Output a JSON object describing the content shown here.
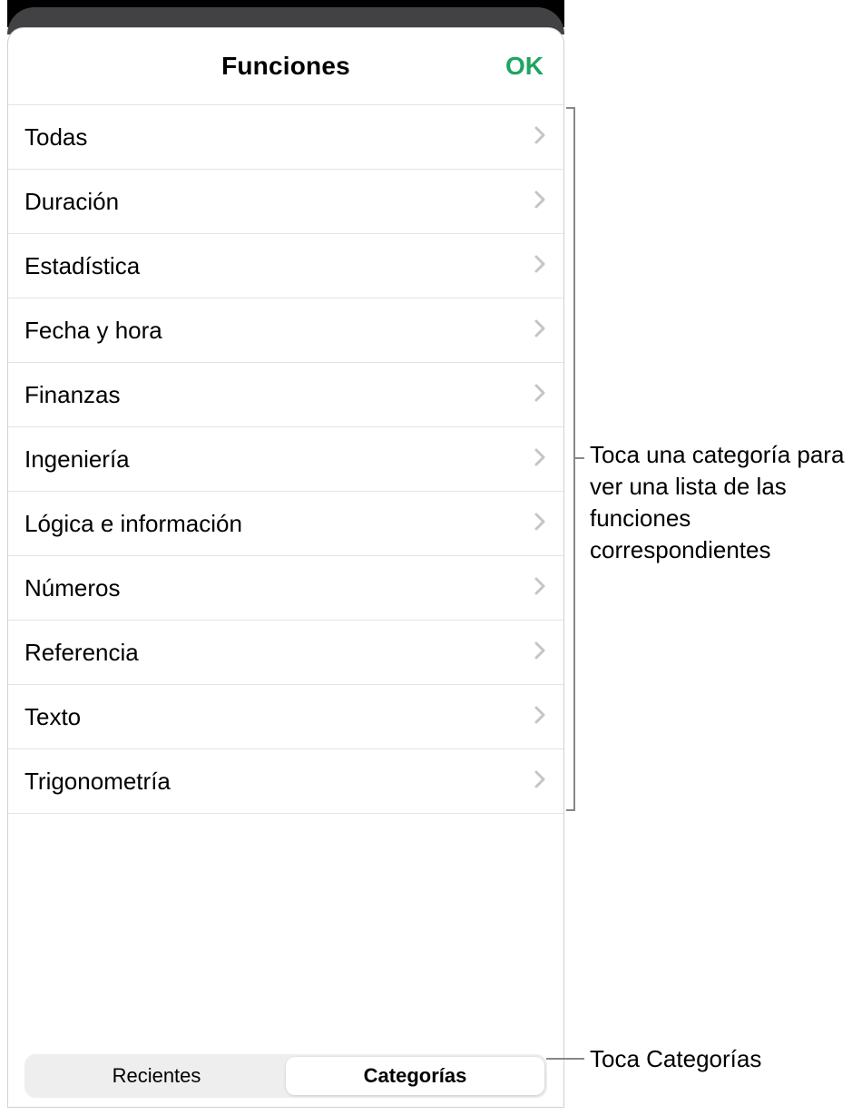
{
  "header": {
    "title": "Funciones",
    "ok": "OK"
  },
  "categories": [
    "Todas",
    "Duración",
    "Estadística",
    "Fecha y hora",
    "Finanzas",
    "Ingeniería",
    "Lógica e información",
    "Números",
    "Referencia",
    "Texto",
    "Trigonometría"
  ],
  "segmented": {
    "recent": "Recientes",
    "categories": "Categorías",
    "selected": "categories"
  },
  "callouts": {
    "list": "Toca una categoría para ver una lista de las funciones correspondientes",
    "seg": "Toca Categorías"
  },
  "colors": {
    "accent": "#1ea463"
  }
}
